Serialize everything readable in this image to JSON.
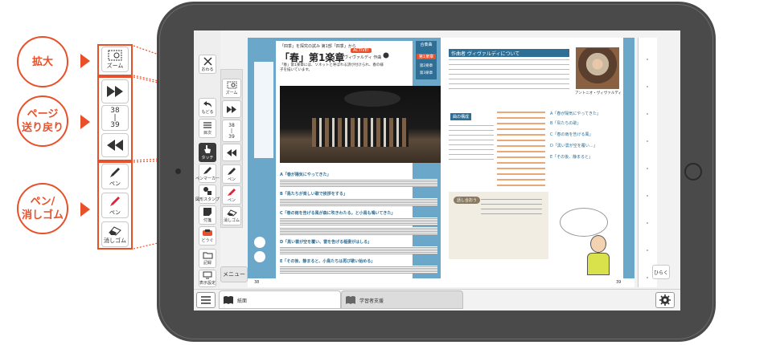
{
  "callouts": {
    "zoom": "拡大",
    "page_line1": "ページ",
    "page_line2": "送り戻り",
    "pen_line1": "ペン/",
    "pen_line2": "消しゴム"
  },
  "legend": {
    "zoom_label": "ズーム",
    "page_current": "38",
    "page_sep": "|",
    "page_total": "39",
    "pen_label": "ペン",
    "red_pen_label": "ペン",
    "eraser_label": "消しゴム"
  },
  "toolbar_left": {
    "close_label": "おわる",
    "back_label": "もどる",
    "toc_label": "目次",
    "touch_label": "タッチ",
    "pen_marker_label": "ペンマーカー",
    "stamp_label": "図形スタンプ",
    "sticky_label": "付箋",
    "tools_label": "どうぐ",
    "record_label": "記録",
    "display_label": "表示設定"
  },
  "toolbar_right": {
    "zoom_label": "ズーム",
    "page_current": "38",
    "page_sep": "|",
    "page_total": "39",
    "pen_label": "ペン",
    "red_pen_label": "ペン",
    "eraser_label": "消しゴム"
  },
  "menu_label": "メニュー",
  "open_label": "ひらく",
  "bottom_tabs": {
    "tab1": "紙面",
    "tab2": "学習者支援"
  },
  "page_left": {
    "subtitle": "「四季」を探究の試み 第1部「四季」から",
    "title": "「春」第1楽章",
    "composer": "ヴィヴァルディ 作曲",
    "badge": "ACTIVE!",
    "side_box_title": "合奏曲",
    "side_box_item1": "第1楽章",
    "side_box_item2": "第2楽章",
    "side_box_item3": "第3楽章",
    "section_a": "A「春が陽気にやってきた」",
    "section_b": "B「鳥たちが楽しい歌で挨拶をする」",
    "section_c": "C「春の雨を告げる風が森に吹きわたる。と小鳥も鳴いてきた」",
    "section_d": "D「黒い雲が空を覆い、雷を告げる稲妻がはしる」",
    "section_e": "E「その後、静まると、小鳥たちは再び歌い始める」",
    "page_number": "38",
    "intro": "「春」第1楽章には、ソネットと呼ばれる詩が付けられ、春の様子を描いています。"
  },
  "page_right": {
    "about_heading": "作曲者 ヴィヴァルディについて",
    "portrait_caption": "アントニオ・ヴィヴァルディ",
    "ritornello_heading": "曲の構成",
    "talk_label": "話し合おう",
    "page_number": "39",
    "rows": [
      "A「春が陽気にやってきた」",
      "B「鳥たちの歌」",
      "C「春の雨を告げる風」",
      "D「黒い雲が空を覆い…」",
      "E「その後、静まると」"
    ]
  },
  "colors": {
    "accent": "#e8502a",
    "page_blue": "#6aa7c9",
    "bezel": "#4a4a4a"
  }
}
